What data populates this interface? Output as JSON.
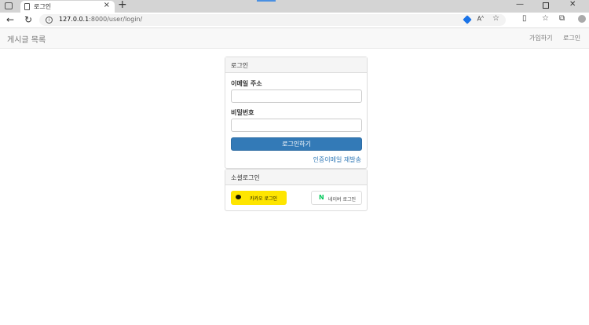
{
  "browser": {
    "tab_title": "로그인",
    "url_host": "127.0.0.1",
    "url_rest": ":8000/user/login/",
    "accent_color": "#1a73e8"
  },
  "navbar": {
    "brand": "게시글 목록",
    "signup_link": "가입하기",
    "login_link": "로그인"
  },
  "login_panel": {
    "heading": "로그인",
    "email_label": "이메일 주소",
    "email_value": "",
    "password_label": "비밀번호",
    "password_value": "",
    "submit_label": "로그인하기",
    "resend_link": "인증이메일 재발송",
    "button_color": "#337ab7"
  },
  "social_panel": {
    "heading": "소셜로그인",
    "kakao_label": "카카오 로그인",
    "kakao_color": "#fee500",
    "naver_icon": "N",
    "naver_label": "네이버 로그인",
    "naver_color": "#03c75a"
  }
}
